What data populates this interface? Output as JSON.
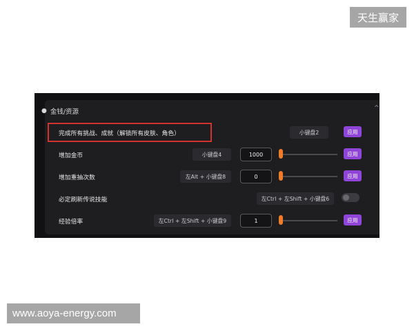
{
  "watermark_top": "天生赢家",
  "watermark_bottom": "www.aoya-energy.com",
  "section": {
    "icon": "coin-icon",
    "title": "金钱/资源"
  },
  "rows": [
    {
      "label": "完成所有挑战、成就（解锁所有皮肤、角色）",
      "hotkey": "小键盘2",
      "apply": "应用"
    },
    {
      "label": "增加金币",
      "hotkey": "小键盘4",
      "value": "1000",
      "apply": "应用"
    },
    {
      "label": "增加重抽次数",
      "hotkey": "左Alt + 小键盘8",
      "value": "0",
      "apply": "应用"
    },
    {
      "label": "必定刷新传说技能",
      "hotkey": "左Ctrl + 左Shift + 小键盘6"
    },
    {
      "label": "经验倍率",
      "hotkey": "左Ctrl + 左Shift + 小键盘9",
      "value": "1",
      "apply": "应用"
    }
  ],
  "colors": {
    "apply": "#8f45d8",
    "slider_knob": "#f07c2a",
    "highlight": "#d2332f"
  }
}
